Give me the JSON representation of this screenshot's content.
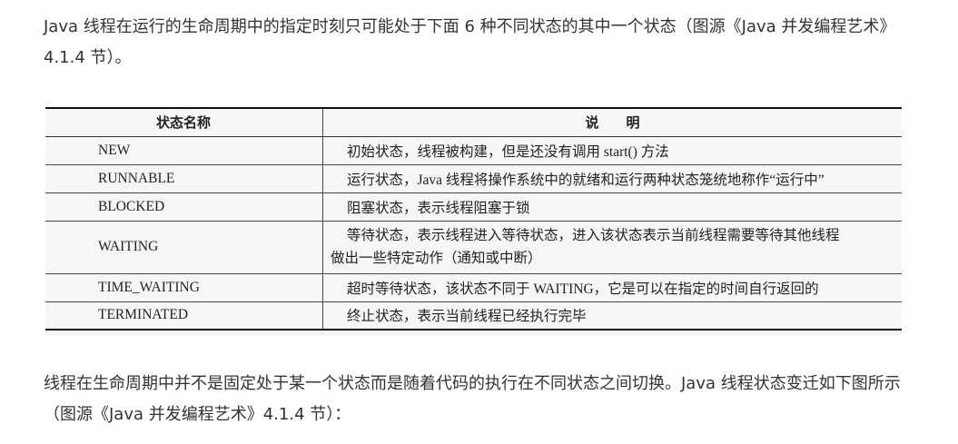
{
  "intro_text": "Java 线程在运行的生命周期中的指定时刻只可能处于下面 6 种不同状态的其中一个状态（图源《Java 并发编程艺术》4.1.4 节）。",
  "table": {
    "headers": [
      "状态名称",
      "说　　明"
    ],
    "rows": [
      {
        "name": "NEW",
        "desc": "初始状态，线程被构建，但是还没有调用 start() 方法"
      },
      {
        "name": "RUNNABLE",
        "desc": "运行状态，Java 线程将操作系统中的就绪和运行两种状态笼统地称作“运行中”"
      },
      {
        "name": "BLOCKED",
        "desc": "阻塞状态，表示线程阻塞于锁"
      },
      {
        "name": "WAITING",
        "desc": "等待状态，表示线程进入等待状态，进入该状态表示当前线程需要等待其他线程",
        "desc2": "做出一些特定动作（通知或中断）"
      },
      {
        "name": "TIME_WAITING",
        "desc": "超时等待状态，该状态不同于 WAITING，它是可以在指定的时间自行返回的"
      },
      {
        "name": "TERMINATED",
        "desc": "终止状态，表示当前线程已经执行完毕"
      }
    ]
  },
  "outro_text": "线程在生命周期中并不是固定处于某一个状态而是随着代码的执行在不同状态之间切换。Java 线程状态变迁如下图所示（图源《Java 并发编程艺术》4.1.4 节）："
}
